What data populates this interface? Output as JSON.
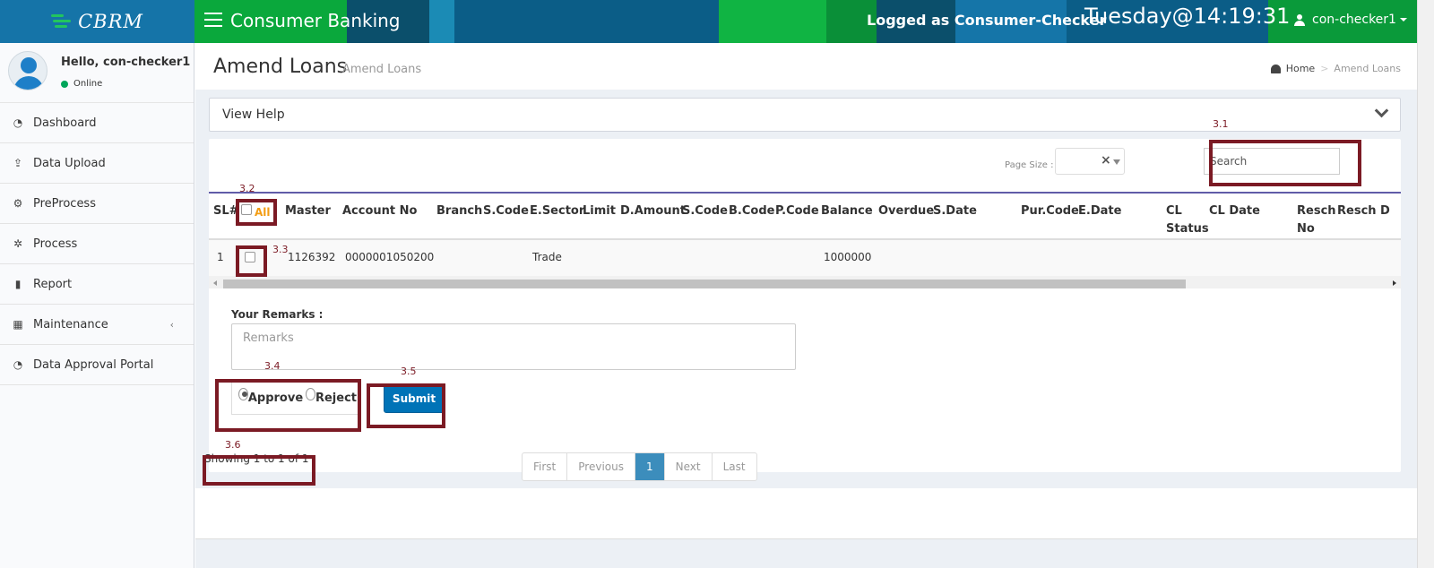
{
  "header": {
    "logo_text": "CBRM",
    "app_title": "Consumer Banking",
    "logged_as": "Logged as Consumer-Checker",
    "clock": "Tuesday@14:19:31",
    "user_name": "con-checker1"
  },
  "sidebar": {
    "greeting": "Hello, con-checker1",
    "status": "Online",
    "items": [
      {
        "label": "Dashboard",
        "icon": "dashboard-icon"
      },
      {
        "label": "Data Upload",
        "icon": "upload-icon"
      },
      {
        "label": "PreProcess",
        "icon": "gears-icon"
      },
      {
        "label": "Process",
        "icon": "gear-icon"
      },
      {
        "label": "Report",
        "icon": "bar-chart-icon"
      },
      {
        "label": "Maintenance",
        "icon": "grid-icon"
      },
      {
        "label": "Data Approval Portal",
        "icon": "dashboard-icon"
      }
    ]
  },
  "page": {
    "title": "Amend Loans",
    "subtitle": "Amend Loans",
    "breadcrumb": {
      "home": "Home",
      "current": "Amend Loans"
    }
  },
  "help": {
    "title": "View Help"
  },
  "toolbar": {
    "page_size_label": "Page Size :",
    "page_size_clear": "×",
    "search_placeholder": "Search"
  },
  "table": {
    "select_all_label": "All",
    "headers": [
      "SL#",
      "Master",
      "Account No",
      "Branch",
      "S.Code",
      "E.Sector",
      "Limit",
      "D.Amount",
      "S.Code",
      "B.Code",
      "P.Code",
      "Balance",
      "Overdue",
      "S.Date",
      "Pur.Code",
      "E.Date",
      "CL Status",
      "CL Date",
      "Resch No",
      "Resch D"
    ],
    "rows": [
      {
        "sl": "1",
        "master": "1126392",
        "account_no": "0000001050200",
        "e_sector": "Trade",
        "balance": "1000000"
      }
    ]
  },
  "form": {
    "remarks_label": "Your Remarks :",
    "remarks_placeholder": "Remarks",
    "approve_label": "Approve",
    "reject_label": "Reject",
    "selected_action": "Approve",
    "submit_label": "Submit"
  },
  "pagination": {
    "showing": "Showing 1 to 1 of 1",
    "first": "First",
    "previous": "Previous",
    "current": "1",
    "next": "Next",
    "last": "Last"
  },
  "annotations": {
    "a31": "3.1",
    "a32": "3.2",
    "a33": "3.3",
    "a34": "3.4",
    "a35": "3.5",
    "a36": "3.6"
  },
  "colors": {
    "header_green": "#0a9a3a",
    "logo_blue": "#1574a8",
    "annotation": "#7b1a24",
    "submit_blue": "#0073b7",
    "active_page": "#3c8dbc",
    "all_label": "#f39c12"
  }
}
